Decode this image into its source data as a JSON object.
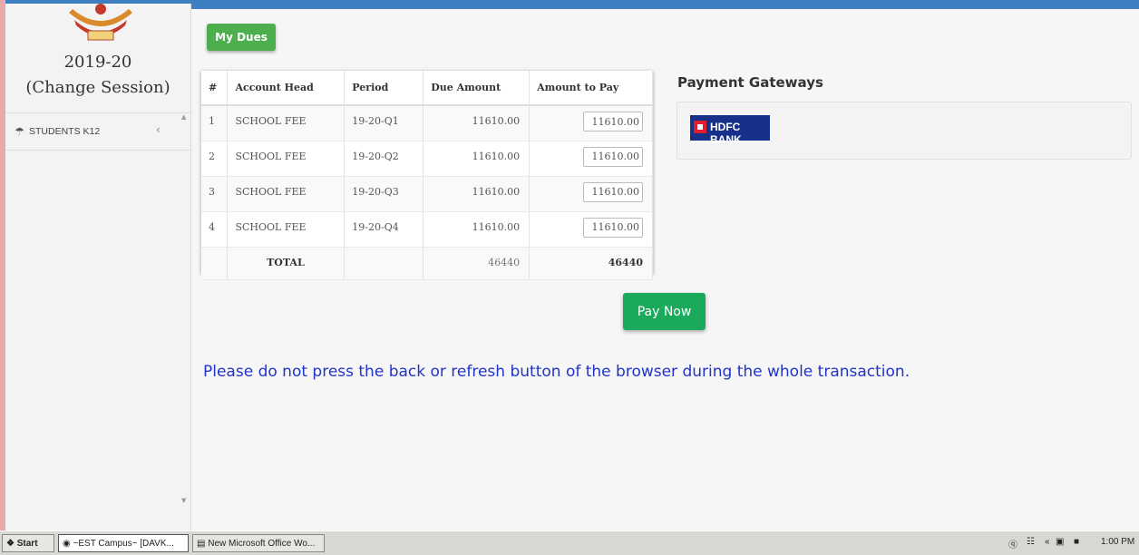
{
  "sidebar": {
    "session_year": "2019-20",
    "session_change": "(Change Session)",
    "item_label": "STUDENTS K12",
    "item_icon": "users-icon"
  },
  "main": {
    "mydues_label": "My Dues",
    "table": {
      "headers": [
        "#",
        "Account Head",
        "Period",
        "Due Amount",
        "Amount to Pay"
      ],
      "rows": [
        {
          "num": "1",
          "head": "SCHOOL FEE",
          "period": "19-20-Q1",
          "due": "11610.00",
          "pay": "11610.00"
        },
        {
          "num": "2",
          "head": "SCHOOL FEE",
          "period": "19-20-Q2",
          "due": "11610.00",
          "pay": "11610.00"
        },
        {
          "num": "3",
          "head": "SCHOOL FEE",
          "period": "19-20-Q3",
          "due": "11610.00",
          "pay": "11610.00"
        },
        {
          "num": "4",
          "head": "SCHOOL FEE",
          "period": "19-20-Q4",
          "due": "11610.00",
          "pay": "11610.00"
        }
      ],
      "total_label": "TOTAL",
      "total_due": "46440",
      "total_pay": "46440"
    },
    "pay_now_label": "Pay Now",
    "warning": "Please do not press the back or refresh button of the browser during the whole transaction."
  },
  "gateways": {
    "title": "Payment Gateways",
    "hdfc_label": "HDFC BANK"
  },
  "taskbar": {
    "start_label": "Start",
    "task1_label": "~EST Campus~ [DAVK...",
    "task2_label": "New Microsoft Office Wo...",
    "clock": "1:00 PM"
  },
  "colors": {
    "accent": "#3d7fc1",
    "green_button": "#4cae4c",
    "pay_button": "#1ba95c",
    "warning_text": "#1f34c8",
    "hdfc_blue": "#17318a"
  }
}
